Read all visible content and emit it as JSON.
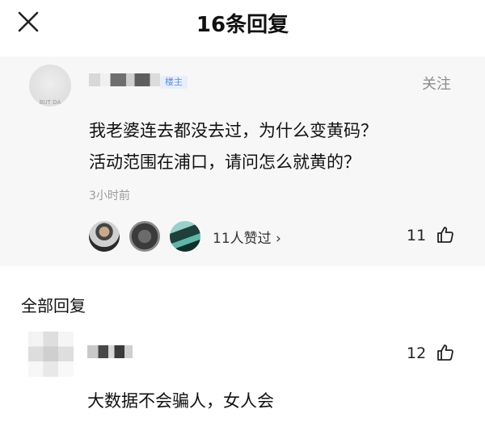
{
  "header": {
    "title": "16条回复",
    "close_icon": "close-icon"
  },
  "op": {
    "badge": "楼主",
    "avatar_caption": "BUT DA",
    "follow_label": "关注",
    "text_line1": "我老婆连去都没去过，为什么变黄码？",
    "text_line2": "活动范围在浦口，请问怎么就黄的？",
    "time": "3小时前",
    "likes_text": "11人赞过 ›",
    "like_count": "11",
    "thumb_icon": "thumbs-up-icon"
  },
  "replies": {
    "section_title": "全部回复",
    "items": [
      {
        "text": "大数据不会骗人，女人会",
        "like_count": "12"
      }
    ]
  }
}
